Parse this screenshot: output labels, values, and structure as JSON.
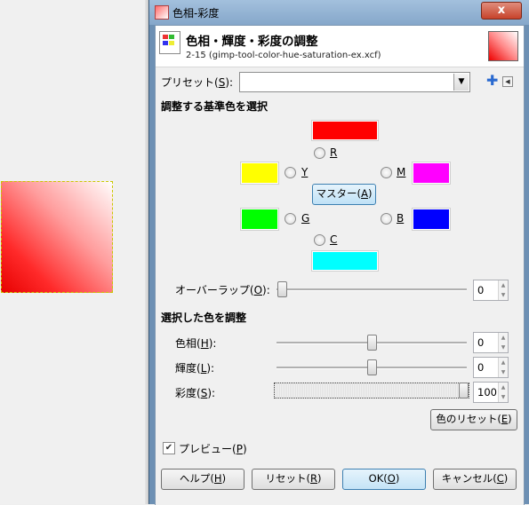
{
  "window": {
    "title": "色相-彩度",
    "close_label": "x"
  },
  "header": {
    "title": "色相・輝度・彩度の調整",
    "subtitle": "2-15 (gimp-tool-color-hue-saturation-ex.xcf)"
  },
  "preset": {
    "label_pre": "プリセット(",
    "label_key": "S",
    "label_post": "):",
    "value": ""
  },
  "primary": {
    "heading": "調整する基準色を選択",
    "colors": {
      "R": "#ff0000",
      "Y": "#ffff00",
      "G": "#00ff00",
      "C": "#00ffff",
      "B": "#0000ff",
      "M": "#ff00ff"
    },
    "labels": {
      "R": "R",
      "Y": "Y",
      "G": "G",
      "C": "C",
      "B": "B",
      "M": "M"
    },
    "master_pre": "マスター(",
    "master_key": "A",
    "master_post": ")"
  },
  "overlap": {
    "label_pre": "オーバーラップ(",
    "label_key": "O",
    "label_post": "):",
    "value": "0"
  },
  "adjust": {
    "heading": "選択した色を調整",
    "hue": {
      "label_pre": "色相(",
      "label_key": "H",
      "label_post": "):",
      "value": "0",
      "level": 0.5
    },
    "lightness": {
      "label_pre": "輝度(",
      "label_key": "L",
      "label_post": "):",
      "value": "0",
      "level": 0.5
    },
    "saturation": {
      "label_pre": "彩度(",
      "label_key": "S",
      "label_post": "):",
      "value": "100",
      "level": 1.0
    },
    "reset_color_pre": "色のリセット(",
    "reset_color_key": "E",
    "reset_color_post": ")"
  },
  "preview": {
    "label_pre": "プレビュー(",
    "label_key": "P",
    "label_post": ")",
    "checked": true
  },
  "buttons": {
    "help": {
      "pre": "ヘルプ(",
      "key": "H",
      "post": ")"
    },
    "reset": {
      "pre": "リセット(",
      "key": "R",
      "post": ")"
    },
    "ok": {
      "pre": "OK(",
      "key": "O",
      "post": ")"
    },
    "cancel": {
      "pre": "キャンセル(",
      "key": "C",
      "post": ")"
    }
  }
}
